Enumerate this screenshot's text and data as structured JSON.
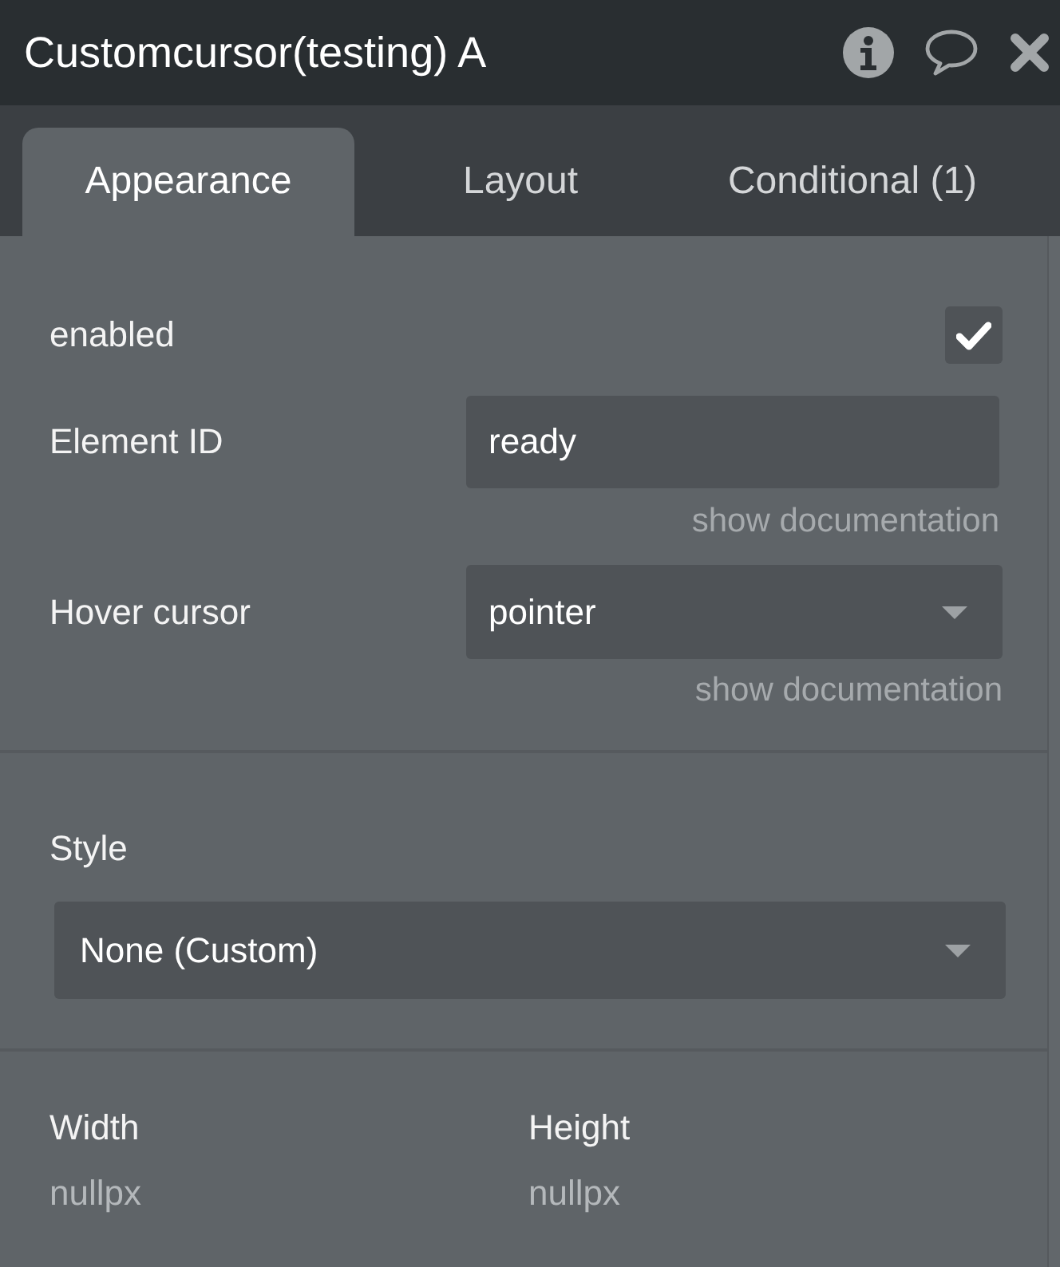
{
  "window": {
    "title": "Customcursor(testing) A"
  },
  "tabs": [
    {
      "label": "Appearance",
      "selected": true
    },
    {
      "label": "Layout",
      "selected": false
    },
    {
      "label": "Conditional (1)",
      "selected": false
    }
  ],
  "properties": [
    {
      "kind": "checkbox",
      "label": "enabled",
      "checked": true
    },
    {
      "kind": "text",
      "label": "Element ID",
      "value": "ready",
      "help_link": "show documentation"
    },
    {
      "kind": "dropdown",
      "label": "Hover cursor",
      "value": "pointer",
      "help_link": "show documentation"
    }
  ],
  "style": {
    "label": "Style",
    "value": "None (Custom)"
  },
  "size": [
    {
      "label": "Width",
      "value": "nullpx"
    },
    {
      "label": "Height",
      "value": "nullpx"
    }
  ]
}
